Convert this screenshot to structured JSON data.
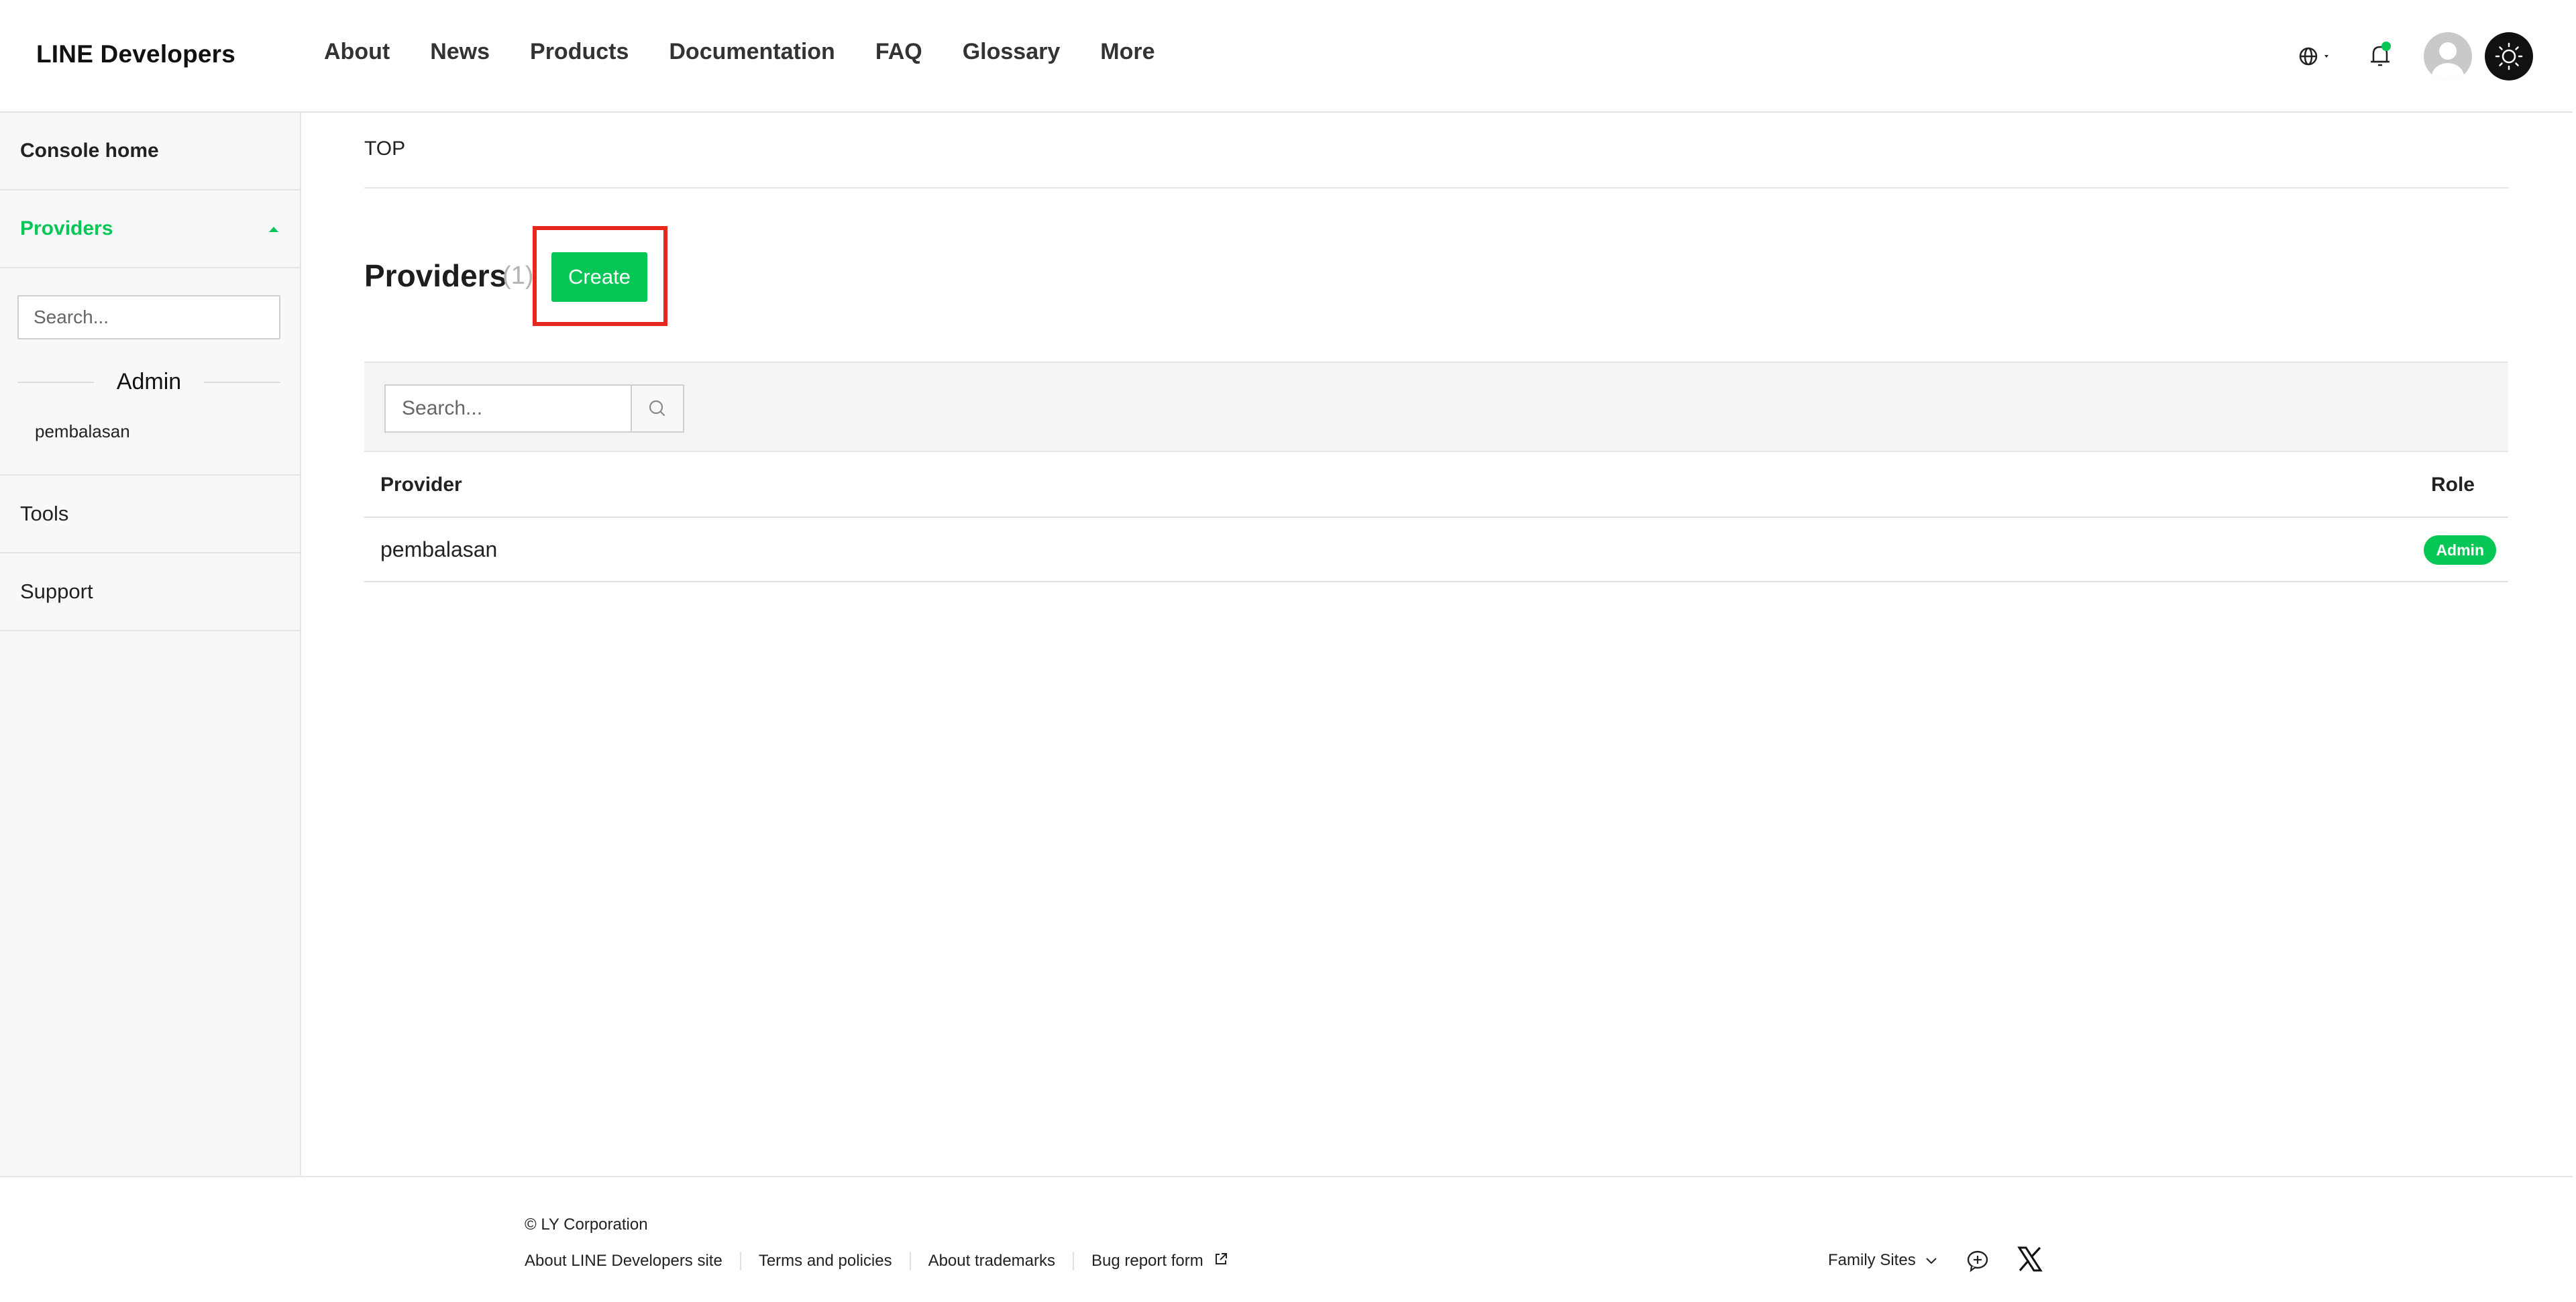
{
  "header": {
    "logo": "LINE Developers",
    "nav": [
      "About",
      "News",
      "Products",
      "Documentation",
      "FAQ",
      "Glossary",
      "More"
    ],
    "icons": [
      "globe-icon",
      "bell-icon",
      "avatar",
      "sun-icon"
    ],
    "notification_dot_color": "#06c755"
  },
  "sidebar": {
    "console_home": "Console home",
    "providers_label": "Providers",
    "search_placeholder": "Search...",
    "role_label": "Admin",
    "provider_items": [
      "pembalasan"
    ],
    "tools": "Tools",
    "support": "Support"
  },
  "main": {
    "breadcrumb": "TOP",
    "title": "Providers",
    "count": "(1)",
    "create_label": "Create",
    "search_placeholder": "Search...",
    "table": {
      "columns": [
        "Provider",
        "Role"
      ],
      "rows": [
        {
          "provider": "pembalasan",
          "role": "Admin"
        }
      ]
    }
  },
  "footer": {
    "copyright": "© LY Corporation",
    "links": [
      "About LINE Developers site",
      "Terms and policies",
      "About trademarks",
      "Bug report form"
    ],
    "family_sites": "Family Sites"
  },
  "colors": {
    "accent": "#06c755",
    "highlight": "#e8281e"
  }
}
